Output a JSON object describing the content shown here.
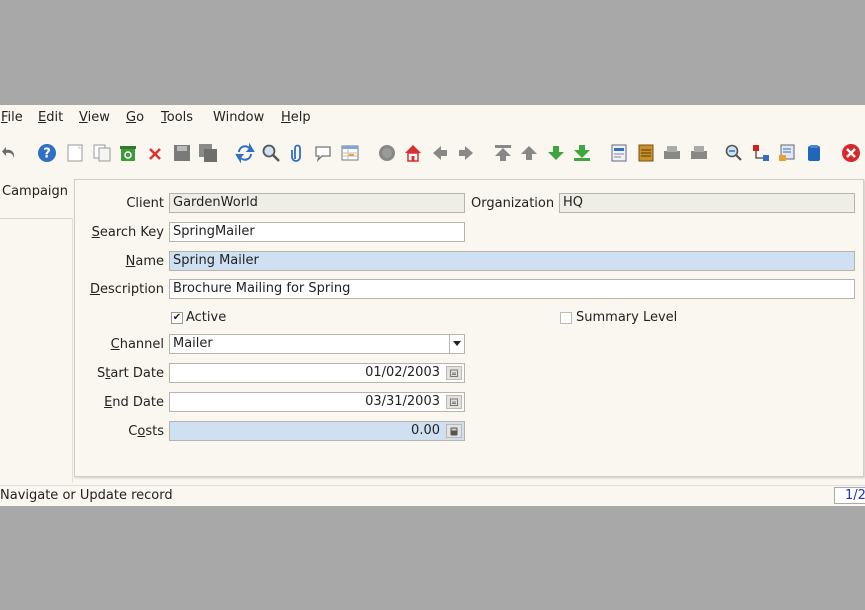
{
  "menu": {
    "file": "File",
    "edit": "Edit",
    "view": "View",
    "go": "Go",
    "tools": "Tools",
    "window": "Window",
    "help": "Help"
  },
  "tab": {
    "label": "Campaign"
  },
  "form": {
    "client_label": "Client",
    "client_value": "GardenWorld",
    "org_label": "Organization",
    "org_value": "HQ",
    "search_key_label": "Search Key",
    "search_key_value": "SpringMailer",
    "name_label": "Name",
    "name_value": "Spring Mailer",
    "description_label": "Description",
    "description_value": "Brochure Mailing for Spring",
    "active_label": "Active",
    "active_checked": true,
    "summary_label": "Summary Level",
    "summary_checked": false,
    "channel_label": "Channel",
    "channel_value": "Mailer",
    "start_date_label": "Start Date",
    "start_date_value": "01/02/2003",
    "end_date_label": "End Date",
    "end_date_value": "03/31/2003",
    "costs_label": "Costs",
    "costs_value": "0.00"
  },
  "status": {
    "text": "Navigate or Update record",
    "record": "1/2"
  },
  "colors": {
    "mandatory_bg": "#cfe0f2",
    "readonly_bg": "#efeee6",
    "window_bg": "#faf7f0"
  }
}
